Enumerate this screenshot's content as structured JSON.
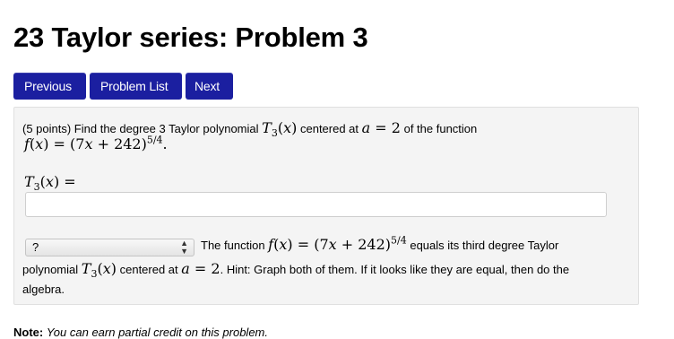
{
  "page": {
    "title": "23 Taylor series: Problem 3"
  },
  "nav": {
    "previous": "Previous",
    "problem_list": "Problem List",
    "next": "Next"
  },
  "problem": {
    "intro_text": "(5 points) Find the degree 3 Taylor polynomial",
    "centered_text": "centered at",
    "of_function_text": "of the function",
    "a_value": "2",
    "answer_label": "=",
    "answer_value": "",
    "select_value": "?",
    "stmt_function_text": "The function",
    "stmt_equals_text": "equals its third degree Taylor",
    "stmt_polynomial_text": "polynomial",
    "stmt_centered_text": "centered at",
    "stmt_hint_text": ". Hint: Graph both of them. If it looks like they are equal, then do the",
    "stmt_algebra_text": "algebra."
  },
  "note": {
    "label": "Note:",
    "text": "You can earn partial credit on this problem."
  }
}
